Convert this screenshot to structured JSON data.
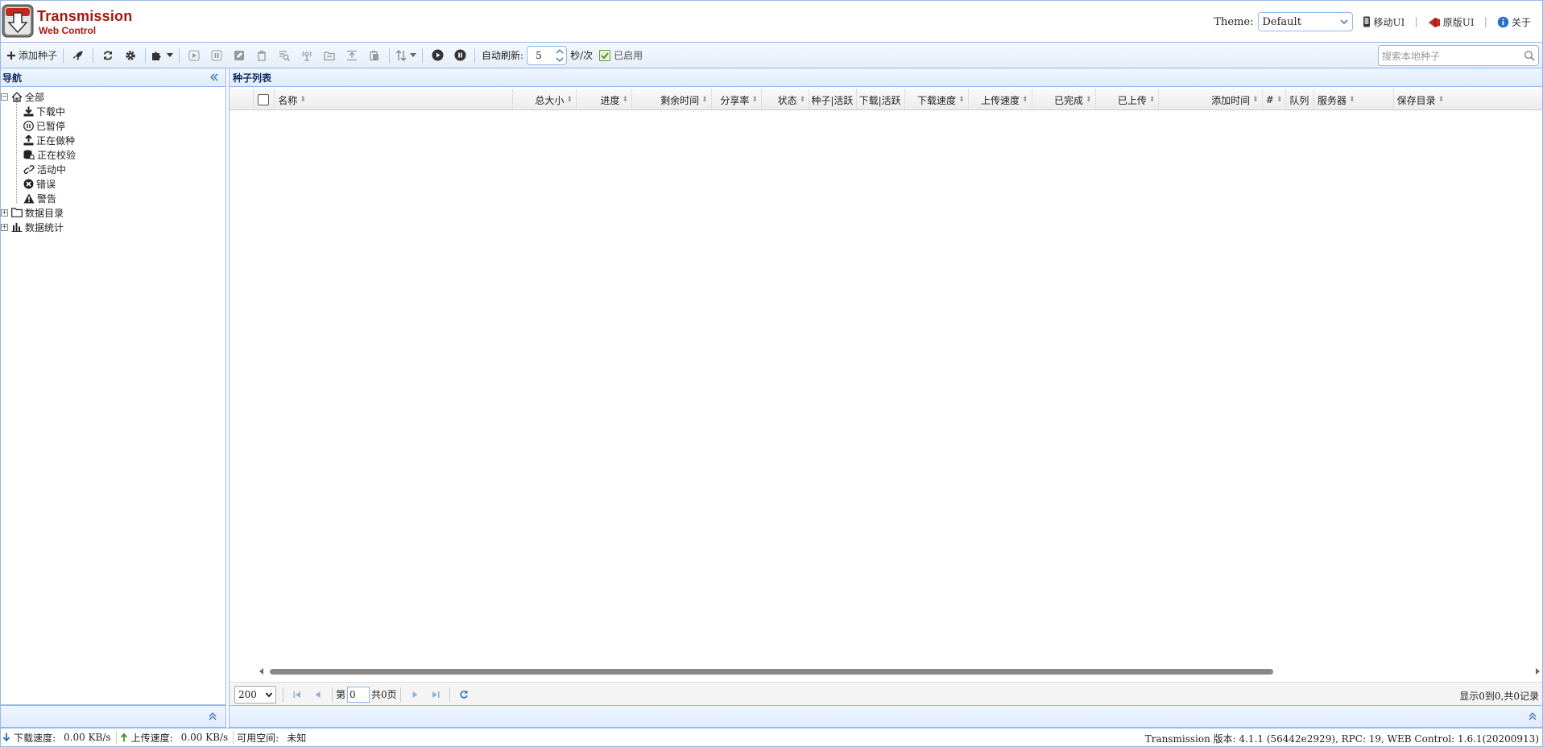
{
  "app": {
    "title": "Transmission",
    "subtitle": "Web Control"
  },
  "header": {
    "theme_label": "Theme:",
    "theme_value": "Default",
    "mobile_ui": "移动UI",
    "original_ui": "原版UI",
    "about": "关于"
  },
  "toolbar": {
    "add_torrent": "添加种子",
    "auto_refresh_label": "自动刷新:",
    "refresh_interval": "5",
    "refresh_unit": "秒/次",
    "enabled_label": "已启用",
    "search_placeholder": "搜索本地种子"
  },
  "nav": {
    "title": "导航",
    "root": "全部",
    "items": [
      {
        "label": "下载中",
        "icon": "download-icon"
      },
      {
        "label": "已暂停",
        "icon": "pause-circle-icon"
      },
      {
        "label": "正在做种",
        "icon": "upload-icon"
      },
      {
        "label": "正在校验",
        "icon": "verify-icon"
      },
      {
        "label": "活动中",
        "icon": "link-icon"
      },
      {
        "label": "错误",
        "icon": "error-icon"
      },
      {
        "label": "警告",
        "icon": "warning-icon"
      }
    ],
    "folders": "数据目录",
    "stats": "数据统计"
  },
  "main": {
    "title": "种子列表",
    "columns": [
      {
        "label": "名称"
      },
      {
        "label": "总大小"
      },
      {
        "label": "进度"
      },
      {
        "label": "剩余时间"
      },
      {
        "label": "分享率"
      },
      {
        "label": "状态"
      },
      {
        "label": "种子|活跃"
      },
      {
        "label": "下载|活跃"
      },
      {
        "label": "下载速度"
      },
      {
        "label": "上传速度"
      },
      {
        "label": "已完成"
      },
      {
        "label": "已上传"
      },
      {
        "label": "添加时间"
      },
      {
        "label": "#"
      },
      {
        "label": "队列"
      },
      {
        "label": "服务器"
      },
      {
        "label": "保存目录"
      }
    ]
  },
  "pager": {
    "page_size": "200",
    "page_prefix": "第",
    "page_value": "0",
    "page_total": "共0页",
    "info": "显示0到0,共0记录"
  },
  "status": {
    "download_label": "下载速度:",
    "download_value": "0.00 KB/s",
    "upload_label": "上传速度:",
    "upload_value": "0.00 KB/s",
    "space_label": "可用空间:",
    "space_value": "未知",
    "version": "Transmission 版本: 4.1.1 (56442e2929), RPC: 19, WEB Control: 1.6.1(20200913)"
  },
  "colors": {
    "accent": "#95b8e7",
    "brand": "#a8170f"
  }
}
